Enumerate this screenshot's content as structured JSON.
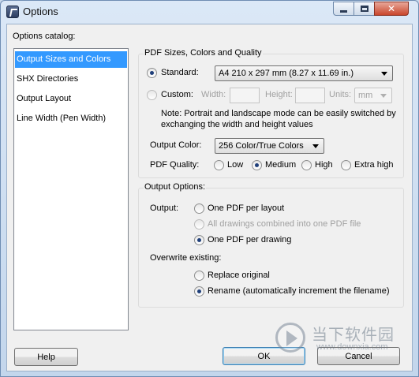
{
  "window": {
    "title": "Options"
  },
  "catalog": {
    "label": "Options catalog:",
    "items": [
      "Output Sizes and Colors",
      "SHX Directories",
      "Output Layout",
      "Line Width (Pen Width)"
    ],
    "selected_index": 0
  },
  "pdf_sizes": {
    "group_title": "PDF Sizes, Colors and Quality",
    "standard_label": "Standard:",
    "standard_value": "A4 210 x 297 mm (8.27 x 11.69 in.)",
    "custom_label": "Custom:",
    "width_label": "Width:",
    "height_label": "Height:",
    "units_label": "Units:",
    "units_value": "mm",
    "size_mode": "Standard",
    "note": "Note: Portrait and landscape mode can be easily switched by exchanging the width and height values",
    "output_color_label": "Output Color:",
    "output_color_value": "256 Color/True Colors",
    "quality_label": "PDF Quality:",
    "quality_options": [
      "Low",
      "Medium",
      "High",
      "Extra high"
    ],
    "quality_selected": "Medium"
  },
  "output_options": {
    "group_title": "Output Options:",
    "output_label": "Output:",
    "output_choices": [
      "One PDF per layout",
      "All drawings combined into one PDF file",
      "One PDF per drawing"
    ],
    "output_selected": "One PDF per drawing",
    "overwrite_label": "Overwrite existing:",
    "overwrite_choices": [
      "Replace original",
      "Rename (automatically increment the filename)"
    ],
    "overwrite_selected": "Rename (automatically increment the filename)"
  },
  "buttons": {
    "help": "Help",
    "ok": "OK",
    "cancel": "Cancel"
  },
  "watermark": {
    "text": "当下软件园",
    "url": "www.downxia.com"
  }
}
